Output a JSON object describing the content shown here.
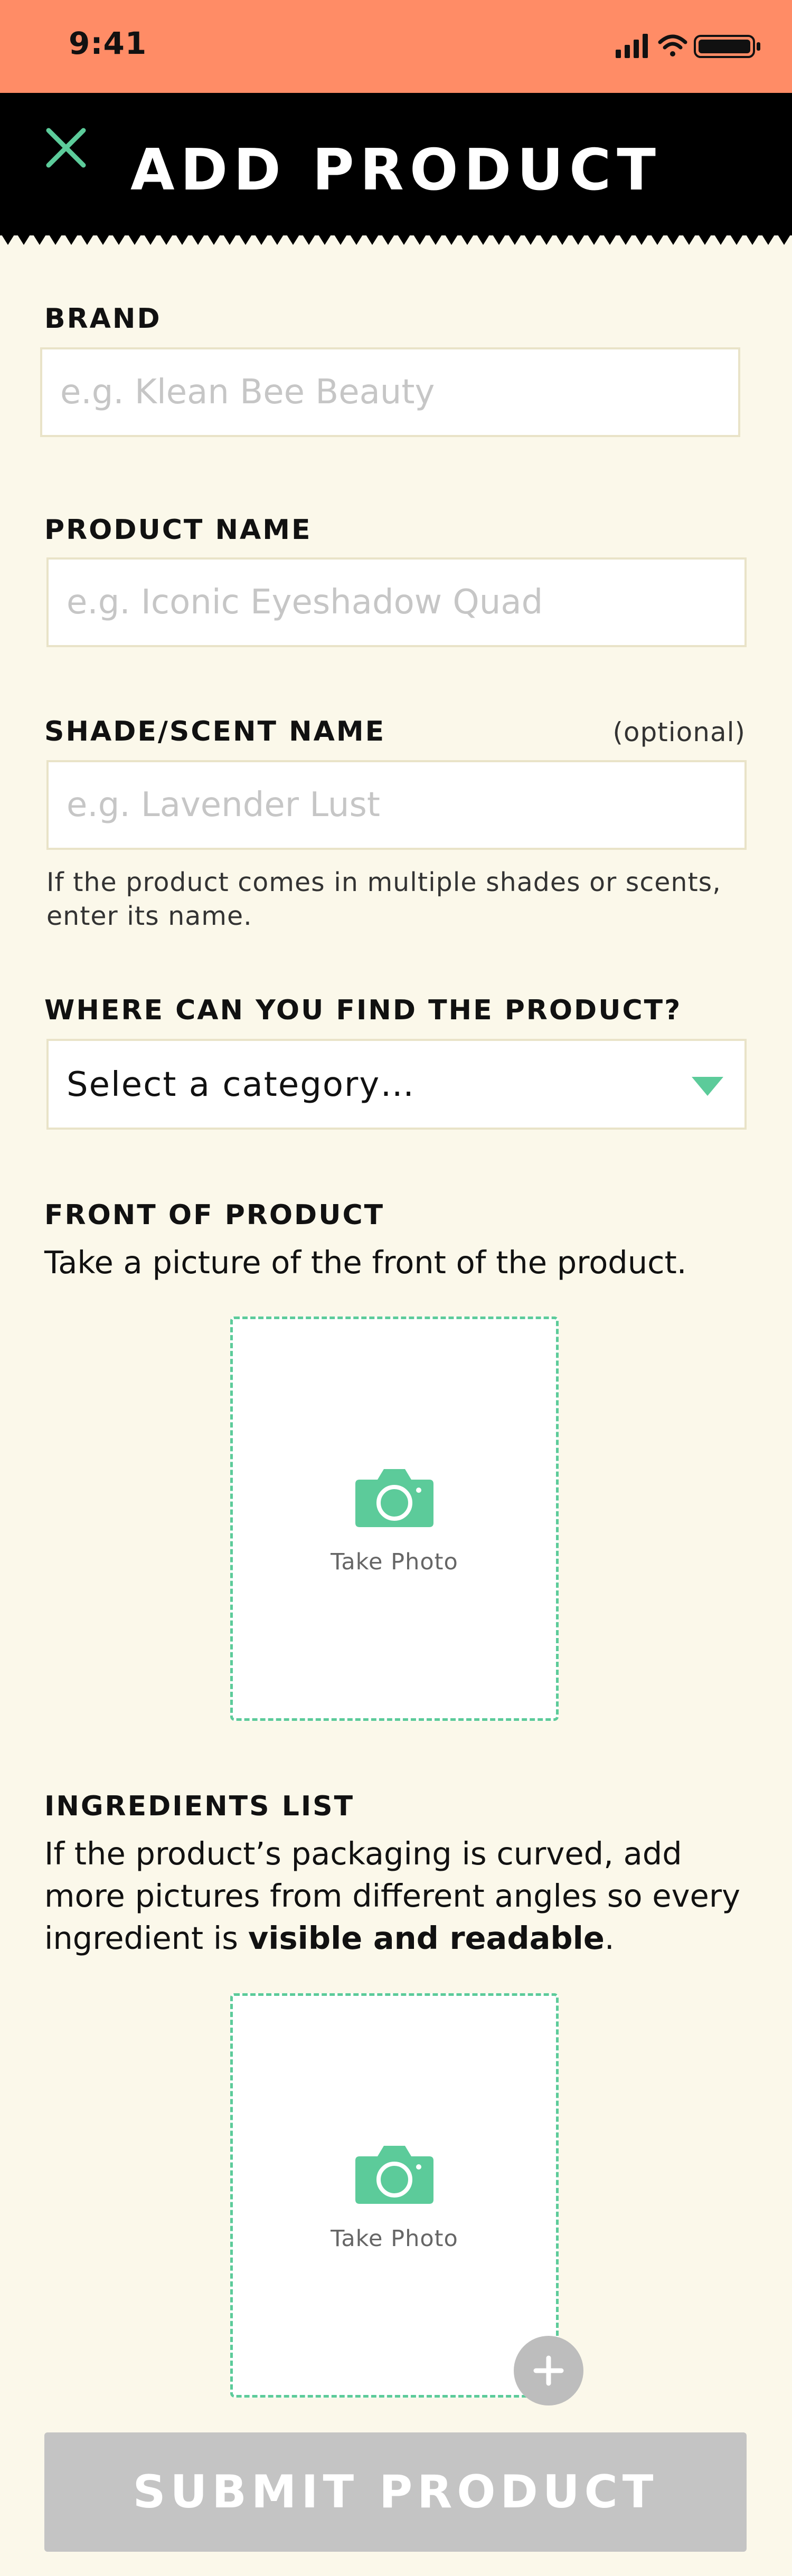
{
  "status_bar": {
    "time": "9:41"
  },
  "header": {
    "title": "ADD PRODUCT"
  },
  "form": {
    "brand": {
      "label": "BRAND",
      "placeholder": "e.g. Klean Bee Beauty",
      "value": ""
    },
    "product_name": {
      "label": "PRODUCT NAME",
      "placeholder": "e.g. Iconic Eyeshadow Quad",
      "value": ""
    },
    "shade": {
      "label": "SHADE/SCENT NAME",
      "optional": "(optional)",
      "placeholder": "e.g. Lavender Lust",
      "value": "",
      "helper": "If the product comes in multiple shades or scents, enter its name."
    },
    "location": {
      "label": "WHERE CAN YOU FIND THE PRODUCT?",
      "selected": "Select a category…"
    },
    "front": {
      "label": "FRONT OF PRODUCT",
      "description": "Take a picture of the front of the product.",
      "take_photo": "Take Photo"
    },
    "ingredients": {
      "label": "INGREDIENTS LIST",
      "description_start": "If the product’s packaging is curved, add more pictures from different angles so every ingredient is ",
      "description_bold": "visible and readable",
      "description_end": ".",
      "take_photo": "Take Photo"
    },
    "submit_label": "SUBMIT PRODUCT"
  },
  "icons": {
    "close": "close-icon",
    "camera": "camera-icon",
    "dropdown": "chevron-down-icon",
    "add": "plus-icon"
  },
  "colors": {
    "status_bar": "#FF8C66",
    "header": "#000000",
    "accent": "#5CCB9A",
    "background": "#FBF8EA",
    "submit_disabled": "#C4C4C4"
  }
}
